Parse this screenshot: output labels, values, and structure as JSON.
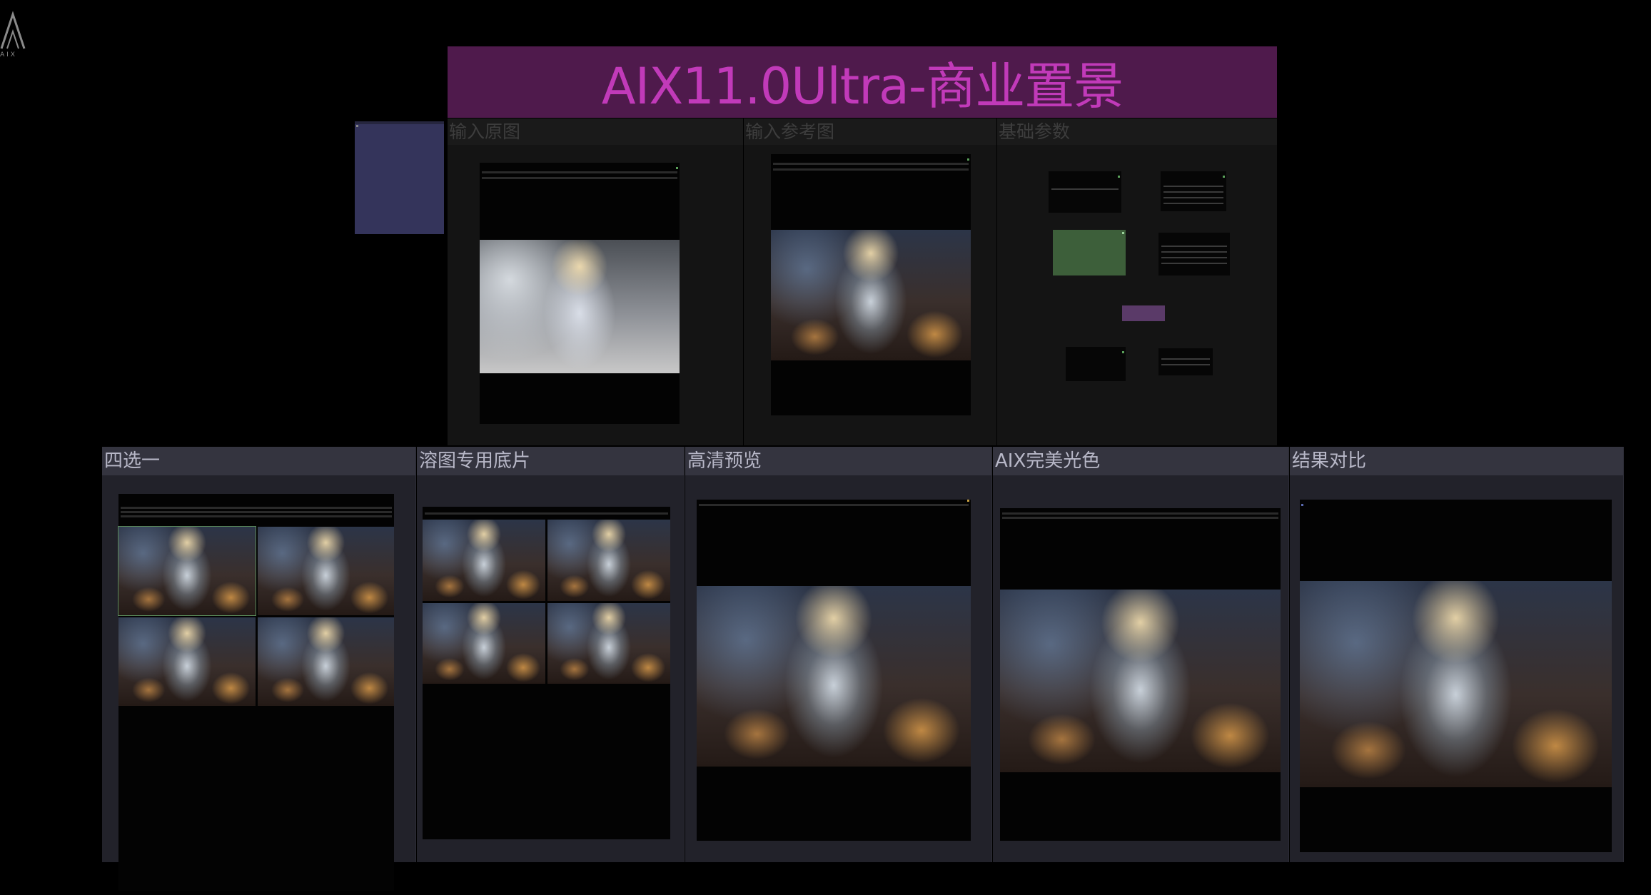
{
  "logo": {
    "icon": "aix-triangle-logo",
    "text": "AIX"
  },
  "title": "AIX11.0Ultra-商业置景",
  "groups": {
    "input_original": "输入原图",
    "input_reference": "输入参考图",
    "basic_params": "基础参数",
    "pick_one_of_four": "四选一",
    "blend_base": "溶图专用底片",
    "hd_preview": "高清预览",
    "aix_light_color": "AIX完美光色",
    "result_compare": "结果对比"
  },
  "colors": {
    "banner_bg": "#4f1a4c",
    "banner_text": "#c13ab9",
    "navy_node": "#34345b",
    "green_node": "#3d5f3a",
    "purple_node": "#5a3a68"
  }
}
